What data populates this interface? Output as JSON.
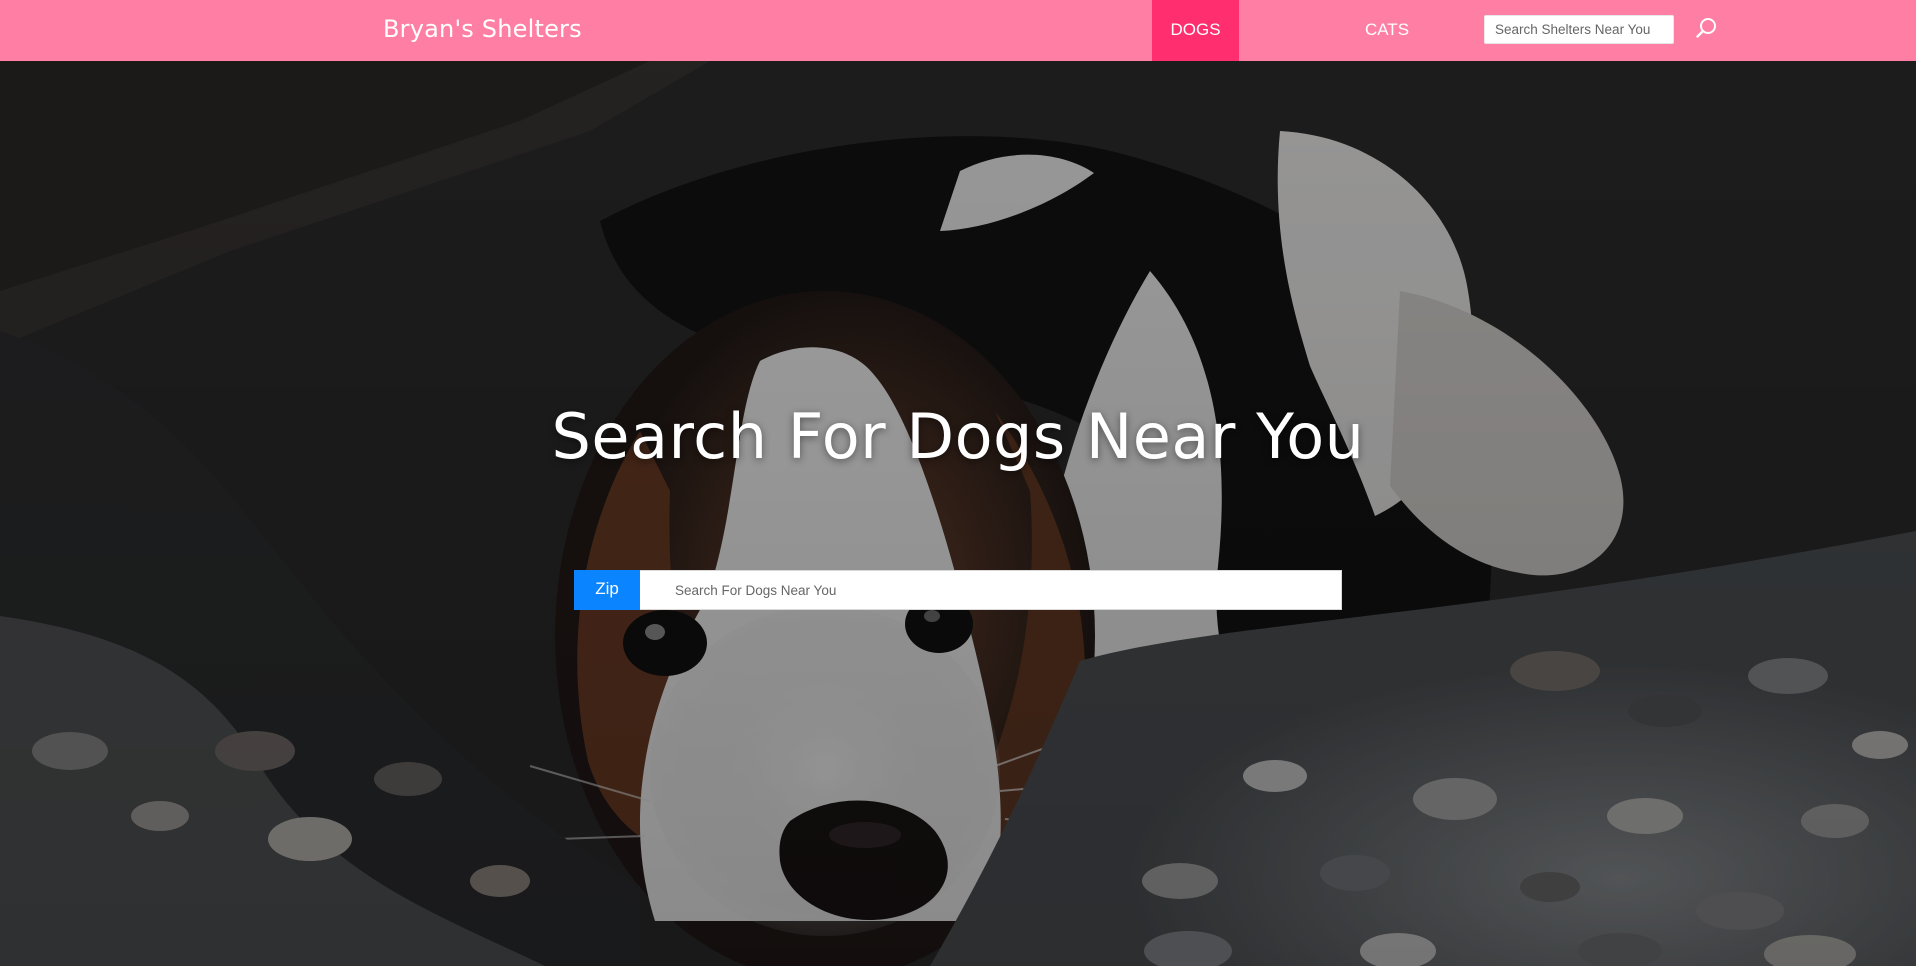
{
  "navbar": {
    "brand": "Bryan's Shelters",
    "links": [
      {
        "label": "DOGS",
        "active": true
      },
      {
        "label": "CATS",
        "active": false
      }
    ],
    "search": {
      "placeholder": "Search Shelters Near You",
      "value": ""
    },
    "search_icon": "search-icon"
  },
  "hero": {
    "title": "Search For Dogs Near You",
    "zip_label": "Zip",
    "zip_input": {
      "placeholder": "Search For Dogs Near You",
      "value": ""
    }
  },
  "colors": {
    "navbar_bg": "#ff7fa4",
    "active_nav_bg": "#ff2f6f",
    "zip_label_bg": "#0a84ff",
    "text_on_dark": "#ffffff"
  }
}
